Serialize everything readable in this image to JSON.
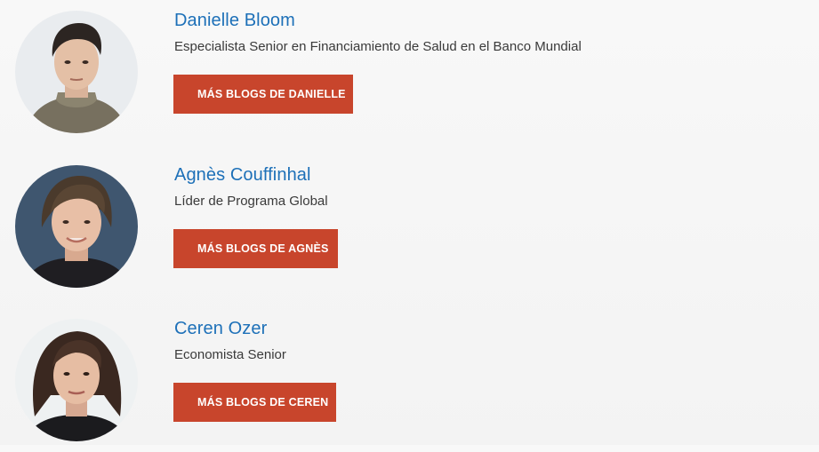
{
  "authors": [
    {
      "name": "Danielle Bloom",
      "role": "Especialista Senior en Financiamiento de Salud en el Banco Mundial",
      "button_label": "MÁS BLOGS DE DANIELLE"
    },
    {
      "name": "Agnès Couffinhal",
      "role": "Líder de Programa Global",
      "button_label": "MÁS BLOGS DE AGNÈS"
    },
    {
      "name": "Ceren Ozer",
      "role": "Economista Senior",
      "button_label": "MÁS BLOGS DE CEREN"
    }
  ],
  "colors": {
    "name_link": "#1d70b8",
    "button_bg": "#c8452c",
    "button_text": "#ffffff",
    "role_text": "#3a3a3a"
  }
}
